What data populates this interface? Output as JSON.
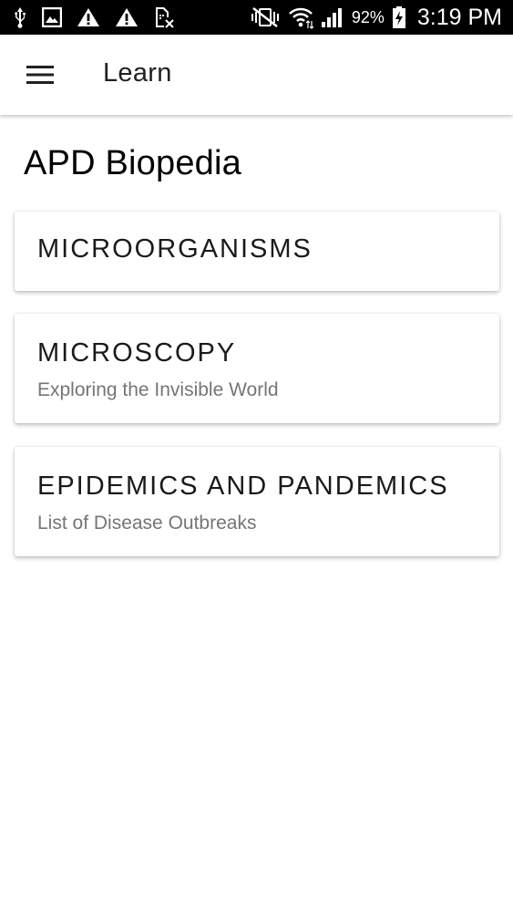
{
  "status_bar": {
    "battery_percent": "92%",
    "time": "3:19 PM",
    "icons": [
      "usb-icon",
      "image-icon",
      "warning-icon",
      "warning-icon",
      "no-sim-icon",
      "vibrate-mute-icon",
      "wifi-icon",
      "signal-icon",
      "battery-charging-icon"
    ]
  },
  "app_bar": {
    "title": "Learn",
    "menu_icon": "hamburger-menu-icon"
  },
  "page": {
    "title": "APD Biopedia"
  },
  "cards": [
    {
      "title": "MICROORGANISMS",
      "subtitle": ""
    },
    {
      "title": "MICROSCOPY",
      "subtitle": "Exploring the Invisible World"
    },
    {
      "title": "EPIDEMICS AND PANDEMICS",
      "subtitle": "List of Disease Outbreaks"
    }
  ],
  "colors": {
    "status_bar_bg": "#000000",
    "app_bar_bg": "#ffffff",
    "text_primary": "#212121",
    "text_secondary": "#757575"
  }
}
